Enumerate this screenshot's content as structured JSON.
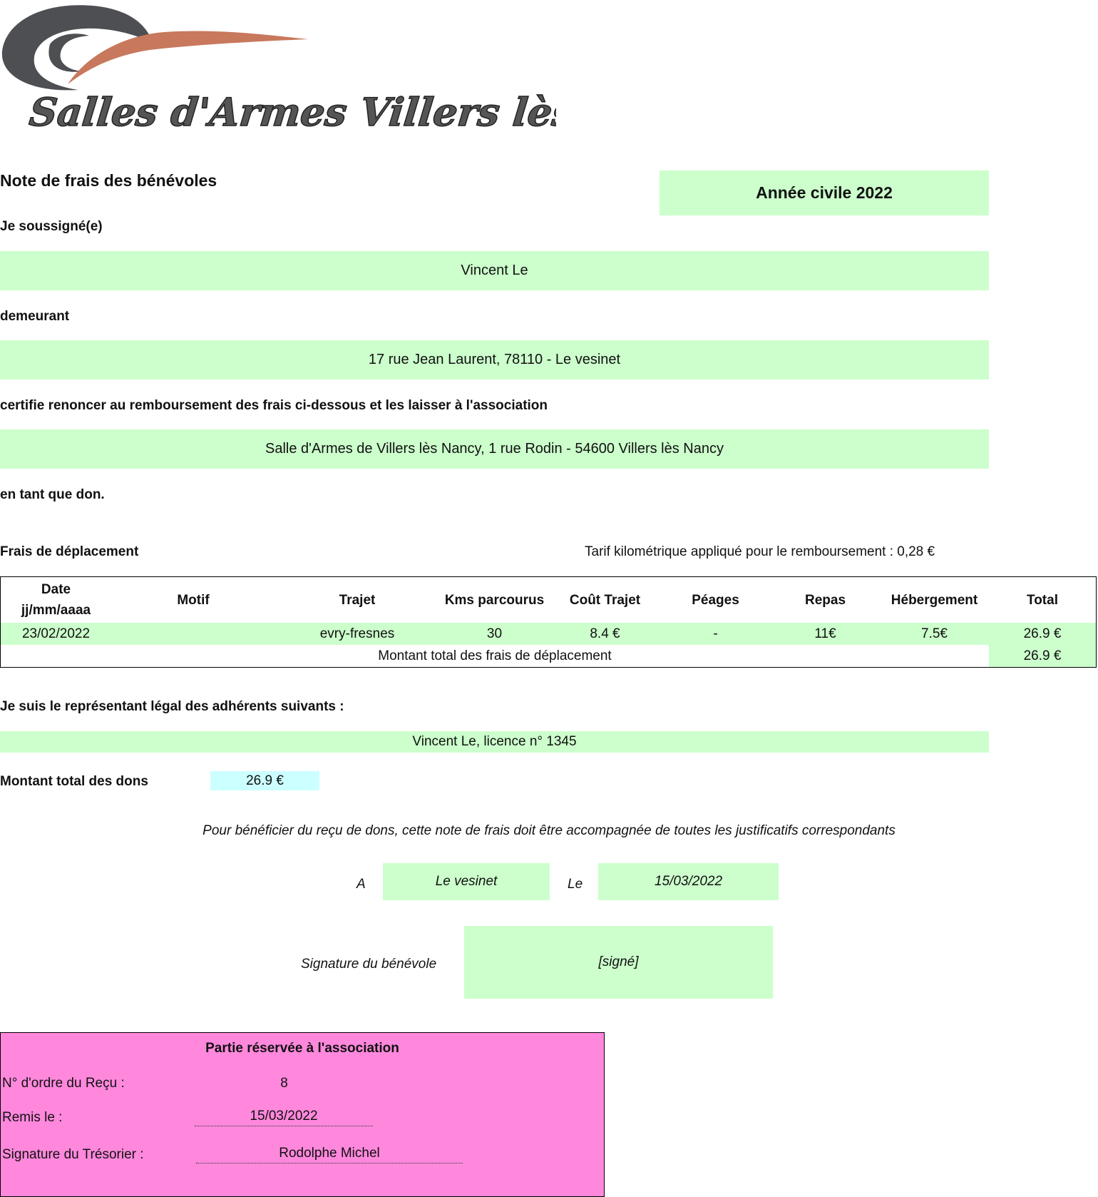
{
  "logo": {
    "text": "Salles d'Armes Villers lès Nancy",
    "colors": {
      "swirl": "#4d4f53",
      "blade": "#c8785c"
    }
  },
  "header": {
    "title": "Note de frais des bénévoles",
    "year_label": "Année civile 2022"
  },
  "identity": {
    "undersigned_label": "Je soussigné(e)",
    "name": "Vincent Le",
    "address_label": "demeurant",
    "address": "17 rue Jean Laurent, 78110 - Le vesinet",
    "certify_label": "certifie renoncer au remboursement des frais ci-dessous et les laisser à l'association",
    "association": "Salle d'Armes de Villers lès Nancy, 1 rue Rodin - 54600 Villers lès Nancy",
    "donation_label": "en tant que don."
  },
  "travel": {
    "section_label": "Frais de déplacement",
    "tariff_text": "Tarif kilométrique appliqué pour le remboursement : 0,28 €",
    "columns": {
      "date_1": "Date",
      "date_2": "jj/mm/aaaa",
      "motif": "Motif",
      "trajet": "Trajet",
      "kms": "Kms parcourus",
      "cout": "Coût Trajet",
      "peages": "Péages",
      "repas": "Repas",
      "hebergement": "Hébergement",
      "total": "Total"
    },
    "rows": [
      {
        "date": "23/02/2022",
        "motif": "",
        "trajet": "evry-fresnes",
        "kms": "30",
        "cout": "8.4 €",
        "peages": "-",
        "repas": "11€",
        "hebergement": "7.5€",
        "total": "26.9 €"
      }
    ],
    "total_label": "Montant total des frais de déplacement",
    "total_value": "26.9 €"
  },
  "representative": {
    "label": "Je suis le représentant légal des adhérents suivants :",
    "members": "Vincent Le, licence n° 1345"
  },
  "donations": {
    "label": "Montant total des dons",
    "value": "26.9 €"
  },
  "notice": "Pour bénéficier du reçu de dons, cette note de frais doit être accompagnée de toutes les justificatifs correspondants",
  "place_date": {
    "place_label": "A",
    "place": "Le vesinet",
    "date_label": "Le",
    "date": "15/03/2022"
  },
  "signature": {
    "label": "Signature du bénévole",
    "value": "[signé]"
  },
  "association_part": {
    "title": "Partie réservée à l'association",
    "receipt_label": "N° d'ordre du Reçu :",
    "receipt_value": "8",
    "given_label": "Remis le :",
    "given_value": "15/03/2022",
    "treasurer_label": "Signature du Trésorier :",
    "treasurer_value": "Rodolphe Michel"
  }
}
